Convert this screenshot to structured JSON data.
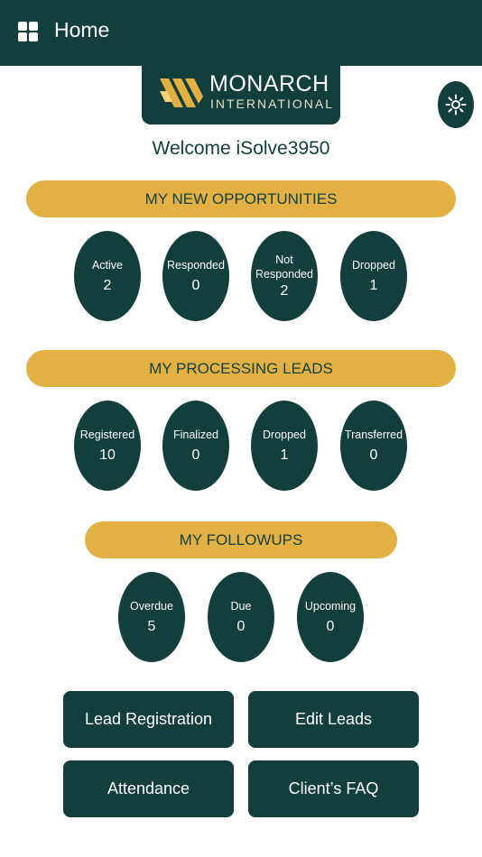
{
  "header": {
    "title": "Home",
    "menu_icon": "grid-menu-icon"
  },
  "logo": {
    "line1": "MONARCH",
    "line2": "INTERNATIONAL",
    "mark_color": "#e3b043"
  },
  "theme_toggle": {
    "icon": "sun-icon"
  },
  "welcome": "Welcome iSolve3950",
  "opportunities": {
    "title": "MY NEW OPPORTUNITIES",
    "items": [
      {
        "label": "Active",
        "value": "2"
      },
      {
        "label": "Responded",
        "value": "0"
      },
      {
        "label": "Not\nResponded",
        "value": "2"
      },
      {
        "label": "Dropped",
        "value": "1"
      }
    ]
  },
  "processing": {
    "title": "MY PROCESSING LEADS",
    "items": [
      {
        "label": "Registered",
        "value": "10"
      },
      {
        "label": "Finalized",
        "value": "0"
      },
      {
        "label": "Dropped",
        "value": "1"
      },
      {
        "label": "Transferred",
        "value": "0"
      }
    ]
  },
  "followups": {
    "title": "MY FOLLOWUPS",
    "items": [
      {
        "label": "Overdue",
        "value": "5"
      },
      {
        "label": "Due",
        "value": "0"
      },
      {
        "label": "Upcoming",
        "value": "0"
      }
    ]
  },
  "actions": {
    "lead_registration": "Lead Registration",
    "edit_leads": "Edit Leads",
    "attendance": "Attendance",
    "clients_faq": "Client’s FAQ"
  },
  "colors": {
    "primary": "#123f3b",
    "accent": "#e3b043",
    "background": "#ffffff"
  }
}
